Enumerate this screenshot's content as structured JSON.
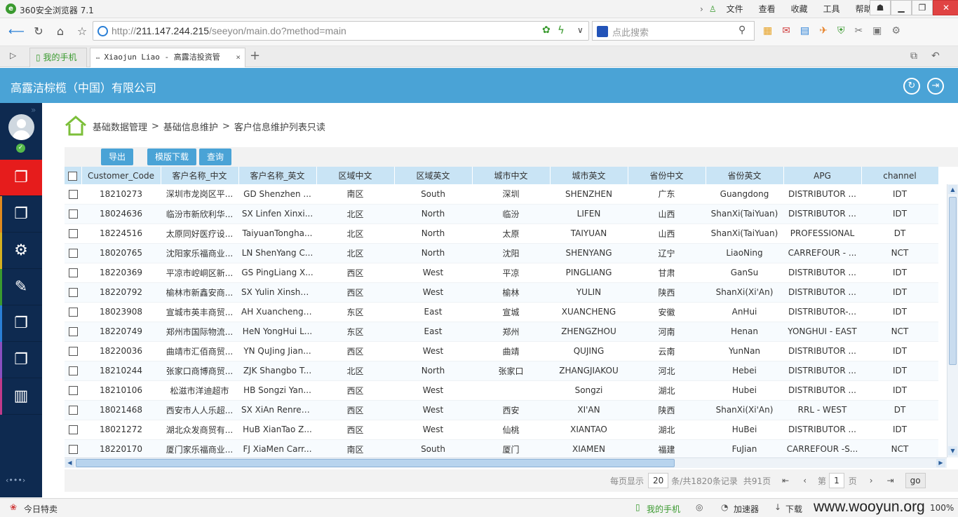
{
  "browser": {
    "title": "360安全浏览器 7.1",
    "menus": [
      "文件",
      "查看",
      "收藏",
      "工具",
      "帮助"
    ],
    "url_prefix": "http://",
    "url_host": "211.147.244.215",
    "url_path": "/seeyon/main.do?method=main",
    "search_placeholder": "点此搜索",
    "tabs": [
      {
        "label": "我的手机"
      },
      {
        "label": "Xiaojun Liao - 高露洁投资管"
      }
    ]
  },
  "app": {
    "company": "高露洁棕榄（中国）有限公司"
  },
  "breadcrumb": {
    "l1": "基础数据管理",
    "sep": ">",
    "l2": "基础信息维护",
    "l3": "客户信息维护列表只读"
  },
  "toolbar": {
    "export": "导出",
    "template": "模版下载",
    "query": "查询"
  },
  "table": {
    "columns": [
      "Customer_Code",
      "客户名称_中文",
      "客户名称_英文",
      "区域中文",
      "区域英文",
      "城市中文",
      "城市英文",
      "省份中文",
      "省份英文",
      "APG",
      "channel"
    ],
    "rows": [
      [
        "18210273",
        "深圳市龙岗区平...",
        "GD Shenzhen ...",
        "南区",
        "South",
        "深圳",
        "SHENZHEN",
        "广东",
        "Guangdong",
        "DISTRIBUTOR ...",
        "IDT"
      ],
      [
        "18024636",
        "临汾市新欣利华...",
        "SX Linfen Xinxi...",
        "北区",
        "North",
        "临汾",
        "LIFEN",
        "山西",
        "ShanXi(TaiYuan)",
        "DISTRIBUTOR ...",
        "IDT"
      ],
      [
        "18224516",
        "太原同好医疗设...",
        "TaiyuanTongha...",
        "北区",
        "North",
        "太原",
        "TAIYUAN",
        "山西",
        "ShanXi(TaiYuan)",
        "PROFESSIONAL",
        "DT"
      ],
      [
        "18020765",
        "沈阳家乐福商业...",
        "LN ShenYang C...",
        "北区",
        "North",
        "沈阳",
        "SHENYANG",
        "辽宁",
        "LiaoNing",
        "CARREFOUR - ...",
        "NCT"
      ],
      [
        "18220369",
        "平凉市崆峒区新...",
        "GS PingLiang X...",
        "西区",
        "West",
        "平凉",
        "PINGLIANG",
        "甘肃",
        "GanSu",
        "DISTRIBUTOR ...",
        "IDT"
      ],
      [
        "18220792",
        "榆林市新鑫安商...",
        "SX Yulin Xinshe...",
        "西区",
        "West",
        "榆林",
        "YULIN",
        "陕西",
        "ShanXi(Xi'An)",
        "DISTRIBUTOR ...",
        "IDT"
      ],
      [
        "18023908",
        "宣城市英丰商贸...",
        "AH Xuancheng ...",
        "东区",
        "East",
        "宣城",
        "XUANCHENG",
        "安徽",
        "AnHui",
        "DISTRIBUTOR-...",
        "IDT"
      ],
      [
        "18220749",
        "郑州市国际物流...",
        "HeN YongHui L...",
        "东区",
        "East",
        "郑州",
        "ZHENGZHOU",
        "河南",
        "Henan",
        "YONGHUI - EAST",
        "NCT"
      ],
      [
        "18220036",
        "曲靖市汇佰商贸...",
        "YN QuJing Jian...",
        "西区",
        "West",
        "曲靖",
        "QUJING",
        "云南",
        "YunNan",
        "DISTRIBUTOR ...",
        "IDT"
      ],
      [
        "18210244",
        "张家口商博商贸...",
        "ZJK Shangbo T...",
        "北区",
        "North",
        "张家口",
        "ZHANGJIAKOU",
        "河北",
        "Hebei",
        "DISTRIBUTOR ...",
        "IDT"
      ],
      [
        "18210106",
        "松滋市洋迪超市",
        "HB Songzi Yan...",
        "西区",
        "West",
        "",
        "Songzi",
        "湖北",
        "Hubei",
        "DISTRIBUTOR ...",
        "IDT"
      ],
      [
        "18021468",
        "西安市人人乐超...",
        "SX XiAn Renrenle",
        "西区",
        "West",
        "西安",
        "XI'AN",
        "陕西",
        "ShanXi(Xi'An)",
        "RRL - WEST",
        "DT"
      ],
      [
        "18021272",
        "湖北众发商贸有...",
        "HuB XianTao Z...",
        "西区",
        "West",
        "仙桃",
        "XIANTAO",
        "湖北",
        "HuBei",
        "DISTRIBUTOR ...",
        "IDT"
      ],
      [
        "18220170",
        "厦门家乐福商业...",
        "FJ XiaMen Carr...",
        "南区",
        "South",
        "厦门",
        "XIAMEN",
        "福建",
        "FuJian",
        "CARREFOUR -S...",
        "NCT"
      ]
    ]
  },
  "pager": {
    "per_page_label": "每页显示",
    "per_page": "20",
    "total_label": "条/共1820条记录",
    "pages_label": "共91页",
    "page_prefix": "第",
    "page": "1",
    "page_suffix": "页",
    "go": "go"
  },
  "status": {
    "left": "今日特卖",
    "phone": "我的手机",
    "accel": "加速器",
    "download": "下载",
    "zoom": "100%",
    "watermark": "www.wooyun.org"
  }
}
